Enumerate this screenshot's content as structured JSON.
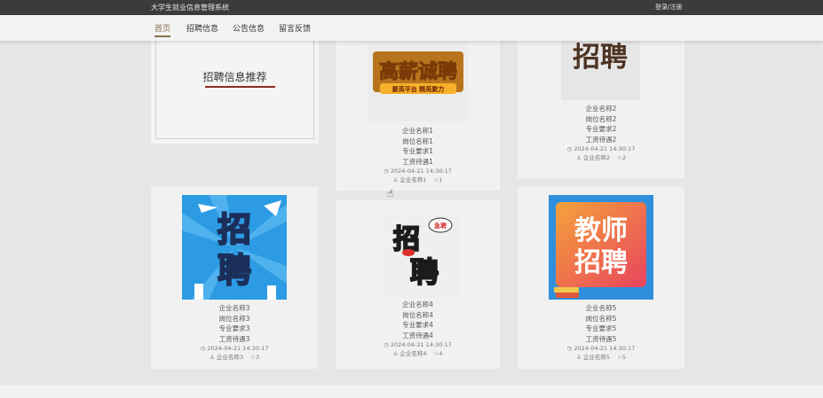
{
  "header": {
    "site_title": "大学生就业信息管理系统",
    "login_label": "登录/注册"
  },
  "nav": {
    "items": [
      "首页",
      "招聘信息",
      "公告信息",
      "留言反馈"
    ],
    "active": "首页"
  },
  "recommend": {
    "title": "招聘信息推荐"
  },
  "icons": {
    "clock": "clock-icon",
    "user": "user-icon",
    "star": "star-icon"
  },
  "cards": [
    {
      "company": "企业名称1",
      "position": "岗位名称1",
      "major": "专业要求1",
      "salary": "工资待遇1",
      "time": "2024-04-21 14:30:17",
      "publisher": "企业名称1",
      "count": "1",
      "image_text_1": "高薪诚聘",
      "image_text_2": "聚英平台  精英聚力"
    },
    {
      "company": "企业名称2",
      "position": "岗位名称2",
      "major": "专业要求2",
      "salary": "工资待遇2",
      "time": "2024-04-21 14:30:17",
      "publisher": "企业名称2",
      "count": "2",
      "image_text_1": "招聘"
    },
    {
      "company": "企业名称3",
      "position": "岗位名称3",
      "major": "专业要求3",
      "salary": "工资待遇3",
      "time": "2024-04-21 14:30:17",
      "publisher": "企业名称3",
      "count": "3",
      "image_text_1": "招",
      "image_text_2": "聘"
    },
    {
      "company": "企业名称4",
      "position": "岗位名称4",
      "major": "专业要求4",
      "salary": "工资待遇4",
      "time": "2024-04-21 14:30:17",
      "publisher": "企业名称4",
      "count": "4",
      "image_text_1": "招",
      "image_text_2": "聘",
      "image_text_3": "急聘"
    },
    {
      "company": "企业名称5",
      "position": "岗位名称5",
      "major": "专业要求5",
      "salary": "工资待遇5",
      "time": "2024-04-21 14:30:17",
      "publisher": "企业名称5",
      "count": "5",
      "image_text_1": "教师",
      "image_text_2": "招聘"
    }
  ]
}
